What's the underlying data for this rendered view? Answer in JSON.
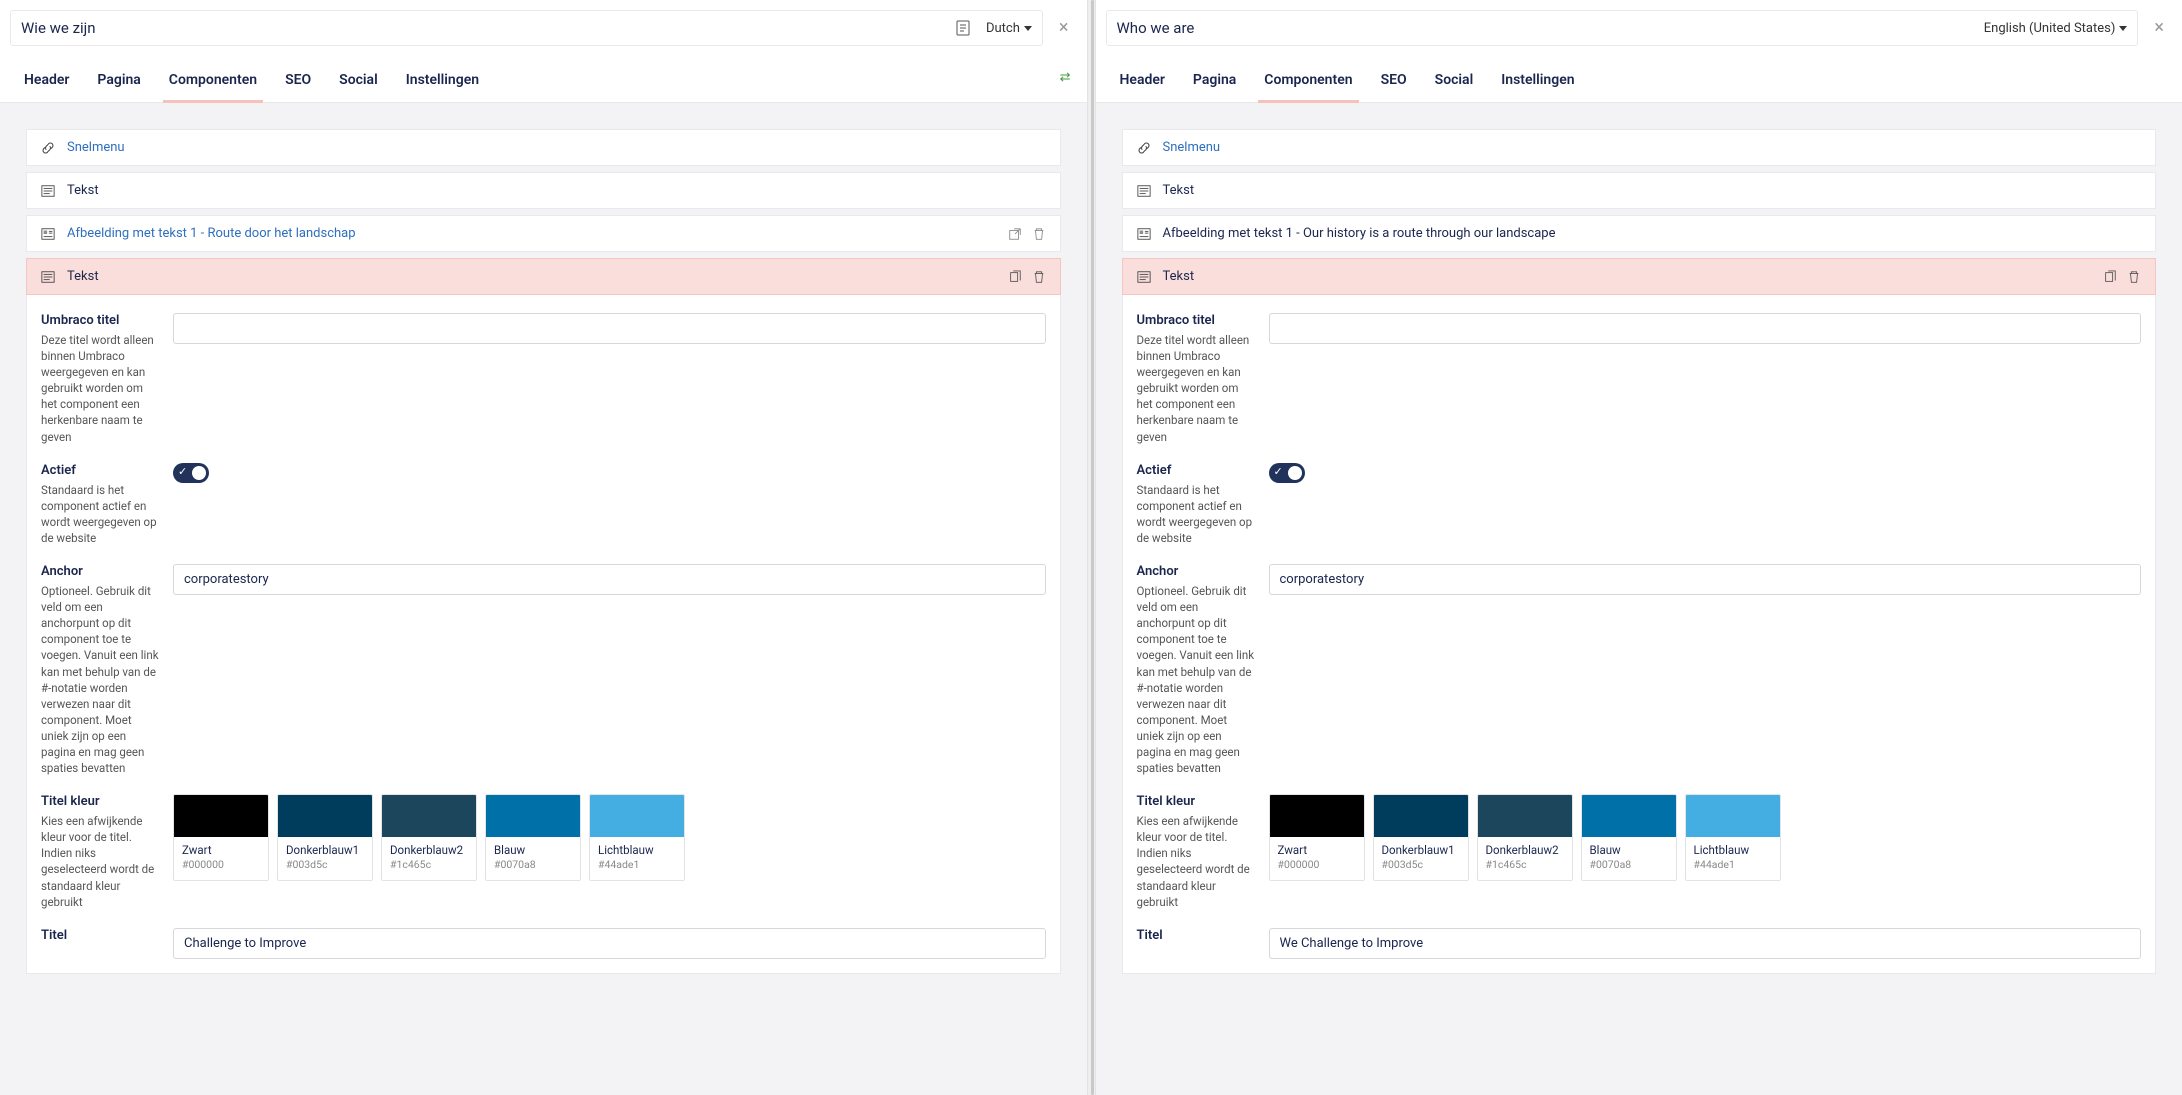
{
  "left": {
    "title": "Wie we zijn",
    "language": "Dutch",
    "tabs": [
      "Header",
      "Pagina",
      "Componenten",
      "SEO",
      "Social",
      "Instellingen"
    ],
    "activeTabIndex": 2,
    "rows": {
      "snelmenu": "Snelmenu",
      "tekst1": "Tekst",
      "afbeelding": "Afbeelding met tekst 1 - Route door het landschap",
      "tekst2": "Tekst"
    },
    "form": {
      "umbraco_titel_label": "Umbraco titel",
      "umbraco_titel_desc": "Deze titel wordt alleen binnen Umbraco weergegeven en kan gebruikt worden om het component een herkenbare naam te geven",
      "umbraco_titel_value": "",
      "actief_label": "Actief",
      "actief_desc": "Standaard is het component actief en wordt weergegeven op de website",
      "actief_value": true,
      "anchor_label": "Anchor",
      "anchor_desc": "Optioneel. Gebruik dit veld om een anchorpunt op dit component toe te voegen. Vanuit een link kan met behulp van de #-notatie worden verwezen naar dit component. Moet uniek zijn op een pagina en mag geen spaties bevatten",
      "anchor_value": "corporatestory",
      "titelkleur_label": "Titel kleur",
      "titelkleur_desc": "Kies een afwijkende kleur voor de titel. Indien niks geselecteerd wordt de standaard kleur gebruikt",
      "titel_label": "Titel",
      "titel_value": "Challenge to Improve"
    }
  },
  "right": {
    "title": "Who we are",
    "language": "English (United States)",
    "tabs": [
      "Header",
      "Pagina",
      "Componenten",
      "SEO",
      "Social",
      "Instellingen"
    ],
    "activeTabIndex": 2,
    "rows": {
      "snelmenu": "Snelmenu",
      "tekst1": "Tekst",
      "afbeelding": "Afbeelding met tekst 1 - Our history is a route through our landscape",
      "tekst2": "Tekst"
    },
    "form": {
      "umbraco_titel_label": "Umbraco titel",
      "umbraco_titel_desc": "Deze titel wordt alleen binnen Umbraco weergegeven en kan gebruikt worden om het component een herkenbare naam te geven",
      "umbraco_titel_value": "",
      "actief_label": "Actief",
      "actief_desc": "Standaard is het component actief en wordt weergegeven op de website",
      "actief_value": true,
      "anchor_label": "Anchor",
      "anchor_desc": "Optioneel. Gebruik dit veld om een anchorpunt op dit component toe te voegen. Vanuit een link kan met behulp van de #-notatie worden verwezen naar dit component. Moet uniek zijn op een pagina en mag geen spaties bevatten",
      "anchor_value": "corporatestory",
      "titelkleur_label": "Titel kleur",
      "titelkleur_desc": "Kies een afwijkende kleur voor de titel. Indien niks geselecteerd wordt de standaard kleur gebruikt",
      "titel_label": "Titel",
      "titel_value": "We Challenge to Improve"
    }
  },
  "swatches": [
    {
      "name": "Zwart",
      "hex": "#000000"
    },
    {
      "name": "Donkerblauw1",
      "hex": "#003d5c"
    },
    {
      "name": "Donkerblauw2",
      "hex": "#1c465c"
    },
    {
      "name": "Blauw",
      "hex": "#0070a8"
    },
    {
      "name": "Lichtblauw",
      "hex": "#44ade1"
    }
  ]
}
